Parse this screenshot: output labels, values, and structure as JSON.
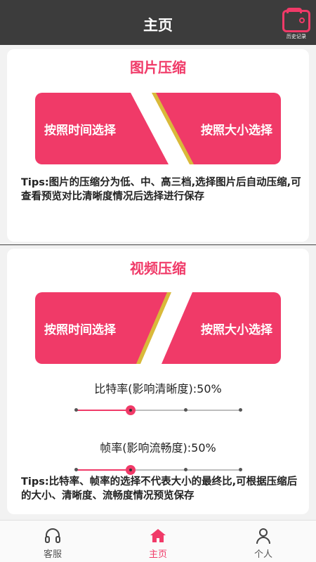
{
  "header": {
    "title": "主页",
    "history_label": "历史记录"
  },
  "image_section": {
    "title": "图片压缩",
    "btn_time": "按照时间选择",
    "btn_size": "按照大小选择",
    "tips": "Tips:图片的压缩分为低、中、高三档,选择图片后自动压缩,可查看预览对比清晰度情况后选择进行保存"
  },
  "video_section": {
    "title": "视频压缩",
    "btn_time": "按照时间选择",
    "btn_size": "按照大小选择",
    "bitrate_label": "比特率(影响清晰度):50%",
    "bitrate_value": 0.5,
    "framerate_label": "帧率(影响流畅度):50%",
    "framerate_value": 0.5,
    "tips": "Tips:比特率、帧率的选择不代表大小的最终比,可根据压缩后的大小、清晰度、流畅度情况预览保存"
  },
  "nav": [
    {
      "label": "客服",
      "icon": "headset-icon"
    },
    {
      "label": "主页",
      "icon": "home-icon",
      "active": true
    },
    {
      "label": "个人",
      "icon": "person-icon"
    }
  ],
  "colors": {
    "accent": "#f03a68",
    "header_bg": "#3c3c3c"
  }
}
